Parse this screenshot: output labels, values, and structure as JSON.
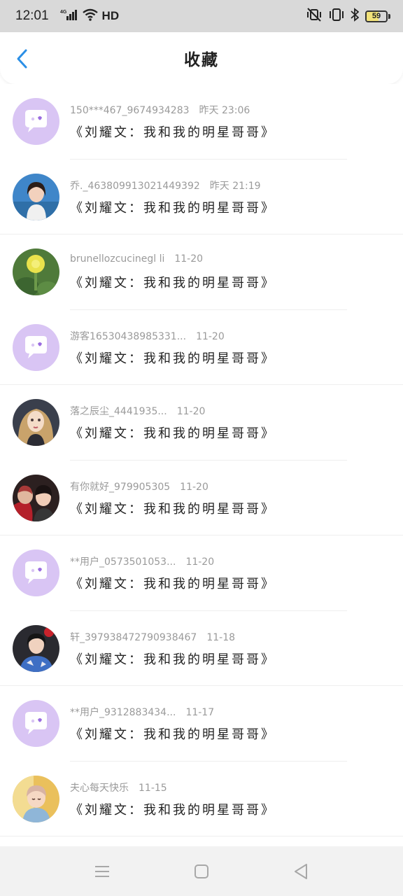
{
  "status_bar": {
    "time": "12:01",
    "network": "4G",
    "hd_label": "HD",
    "battery_level": "59"
  },
  "header": {
    "title": "收藏"
  },
  "items": [
    {
      "user": "150***467_9674934283",
      "time": "昨天 23:06",
      "title": "《刘耀文：我和我的明星哥哥》",
      "avatar": "default-chat-avatar"
    },
    {
      "user": "乔._463809913021449392",
      "time": "昨天 21:19",
      "title": "《刘耀文：我和我的明星哥哥》",
      "avatar": "photo-girl-avatar"
    },
    {
      "user": "brunellozcucinegl li",
      "time": "11-20",
      "title": "《刘耀文：我和我的明星哥哥》",
      "avatar": "photo-flower-avatar"
    },
    {
      "user": "游客16530438985331...",
      "time": "11-20",
      "title": "《刘耀文：我和我的明星哥哥》",
      "avatar": "default-chat-avatar"
    },
    {
      "user": "落之辰尘_4441935...",
      "time": "11-20",
      "title": "《刘耀文：我和我的明星哥哥》",
      "avatar": "photo-anime-girl-avatar"
    },
    {
      "user": "有你就好_979905305",
      "time": "11-20",
      "title": "《刘耀文：我和我的明星哥哥》",
      "avatar": "photo-people-avatar"
    },
    {
      "user": "**用户_0573501053...",
      "time": "11-20",
      "title": "《刘耀文：我和我的明星哥哥》",
      "avatar": "default-chat-avatar"
    },
    {
      "user": "轩_397938472790938467",
      "time": "11-18",
      "title": "《刘耀文：我和我的明星哥哥》",
      "avatar": "photo-boy-avatar"
    },
    {
      "user": "**用户_9312883434...",
      "time": "11-17",
      "title": "《刘耀文：我和我的明星哥哥》",
      "avatar": "default-chat-avatar"
    },
    {
      "user": "夫心每天快乐",
      "time": "11-15",
      "title": "《刘耀文：我和我的明星哥哥》",
      "avatar": "photo-child-avatar"
    }
  ],
  "colors": {
    "accent": "#2b8fe6",
    "default_avatar_bg": "#d9c5f4",
    "default_avatar_icon": "#ffffff"
  }
}
